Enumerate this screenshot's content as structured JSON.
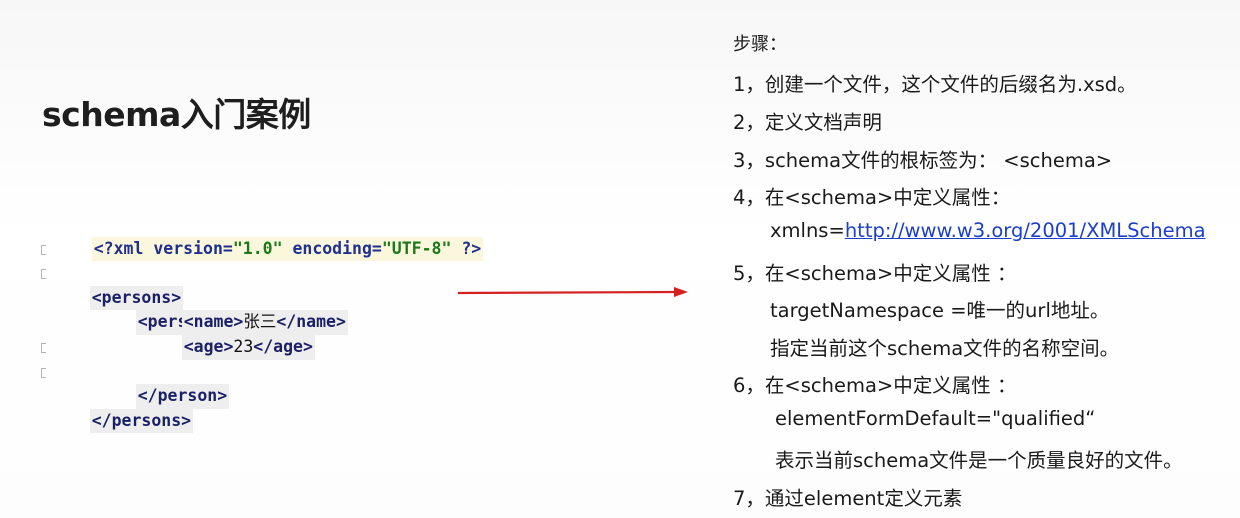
{
  "title": "schema入门案例",
  "code": {
    "lines": [
      {
        "id": "decl",
        "parts": [
          {
            "t": "<?xml ",
            "c": "k-decl"
          },
          {
            "t": "version=",
            "c": "k-attr"
          },
          {
            "t": "\"1.0\"",
            "c": "k-str"
          },
          {
            "t": " encoding=",
            "c": "k-attr"
          },
          {
            "t": "\"UTF-8\"",
            "c": "k-str"
          },
          {
            "t": " ?>",
            "c": "k-decl"
          }
        ]
      },
      {
        "id": "persons-open",
        "parts": [
          {
            "t": "<persons>",
            "c": "k-tag"
          }
        ]
      },
      {
        "id": "person-open",
        "parts": [
          {
            "t": "<person>",
            "c": "k-tag"
          }
        ]
      },
      {
        "id": "name",
        "parts": [
          {
            "t": "<name>",
            "c": "k-tag"
          },
          {
            "t": "张三",
            "c": "k-text"
          },
          {
            "t": "</name>",
            "c": "k-tag"
          }
        ]
      },
      {
        "id": "age",
        "parts": [
          {
            "t": "<age>",
            "c": "k-tag"
          },
          {
            "t": "23",
            "c": "k-text"
          },
          {
            "t": "</age>",
            "c": "k-tag"
          }
        ]
      },
      {
        "id": "person-close",
        "parts": [
          {
            "t": "</person>",
            "c": "k-tag"
          }
        ]
      },
      {
        "id": "persons-close",
        "parts": [
          {
            "t": "</persons>",
            "c": "k-tag"
          }
        ]
      }
    ]
  },
  "steps": {
    "heading": "步骤：",
    "s1": "1，创建一个文件，这个文件的后缀名为.xsd。",
    "s2": "2，定义文档声明",
    "s3": "3，schema文件的根标签为： <schema>",
    "s4": "4，在<schema>中定义属性：",
    "s4_prefix": "xmlns=",
    "s4_link": "http://www.w3.org/2001/XMLSchema",
    "s5": "5，在<schema>中定义属性 ：",
    "s5_a": "targetNamespace =唯一的url地址。",
    "s5_b": "指定当前这个schema文件的名称空间。",
    "s6": "6，在<schema>中定义属性 ：",
    "s6_a": "elementFormDefault=\"qualified“",
    "s6_b": "表示当前schema文件是一个质量良好的文件。",
    "s7": "7，通过element定义元素"
  },
  "colors": {
    "arrow": "#d42020",
    "link": "#1b3fcc"
  }
}
